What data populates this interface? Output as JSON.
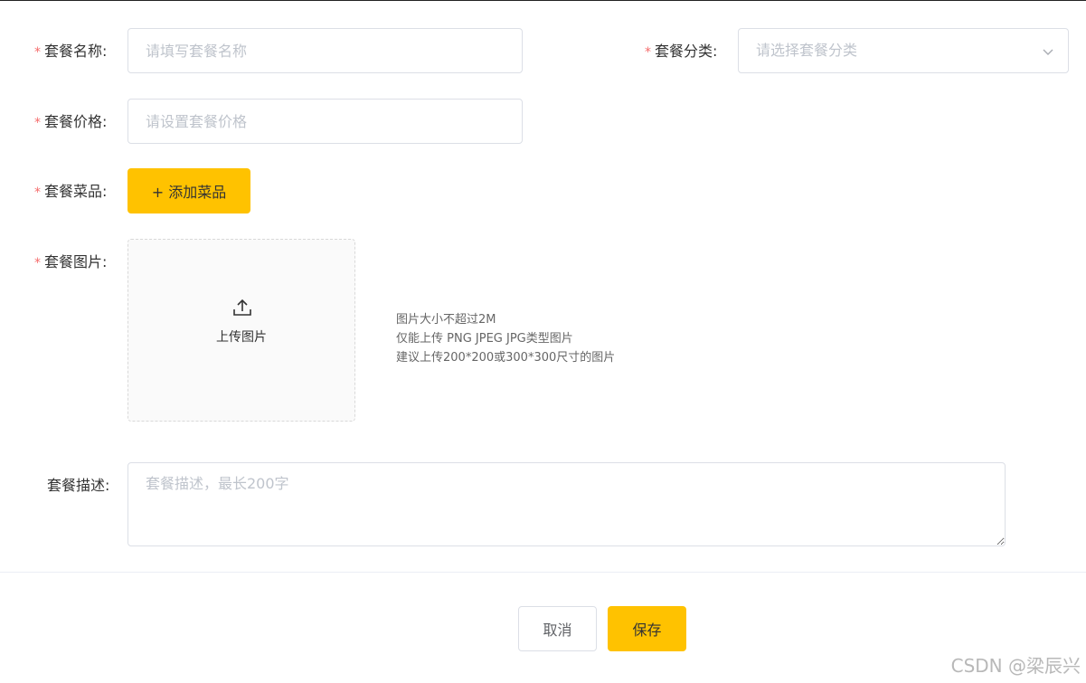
{
  "form": {
    "name": {
      "label": "套餐名称:",
      "placeholder": "请填写套餐名称",
      "required_mark": "*"
    },
    "category": {
      "label": "套餐分类:",
      "placeholder": "请选择套餐分类",
      "required_mark": "*",
      "icon": "chevron-down-icon"
    },
    "price": {
      "label": "套餐价格:",
      "placeholder": "请设置套餐价格",
      "required_mark": "*"
    },
    "dishes": {
      "label": "套餐菜品:",
      "button": "+ 添加菜品",
      "required_mark": "*"
    },
    "image": {
      "label": "套餐图片:",
      "required_mark": "*",
      "upload_text": "上传图片",
      "icon": "upload-icon",
      "tips": [
        "图片大小不超过2M",
        "仅能上传 PNG JPEG JPG类型图片",
        "建议上传200*200或300*300尺寸的图片"
      ]
    },
    "description": {
      "label": "套餐描述:",
      "placeholder": "套餐描述，最长200字"
    }
  },
  "actions": {
    "cancel": "取消",
    "save": "保存"
  },
  "watermark": "CSDN @梁辰兴",
  "colors": {
    "accent": "#ffc200",
    "required": "#f56c6c",
    "border": "#dcdfe6",
    "placeholder": "#bfc4cc"
  }
}
